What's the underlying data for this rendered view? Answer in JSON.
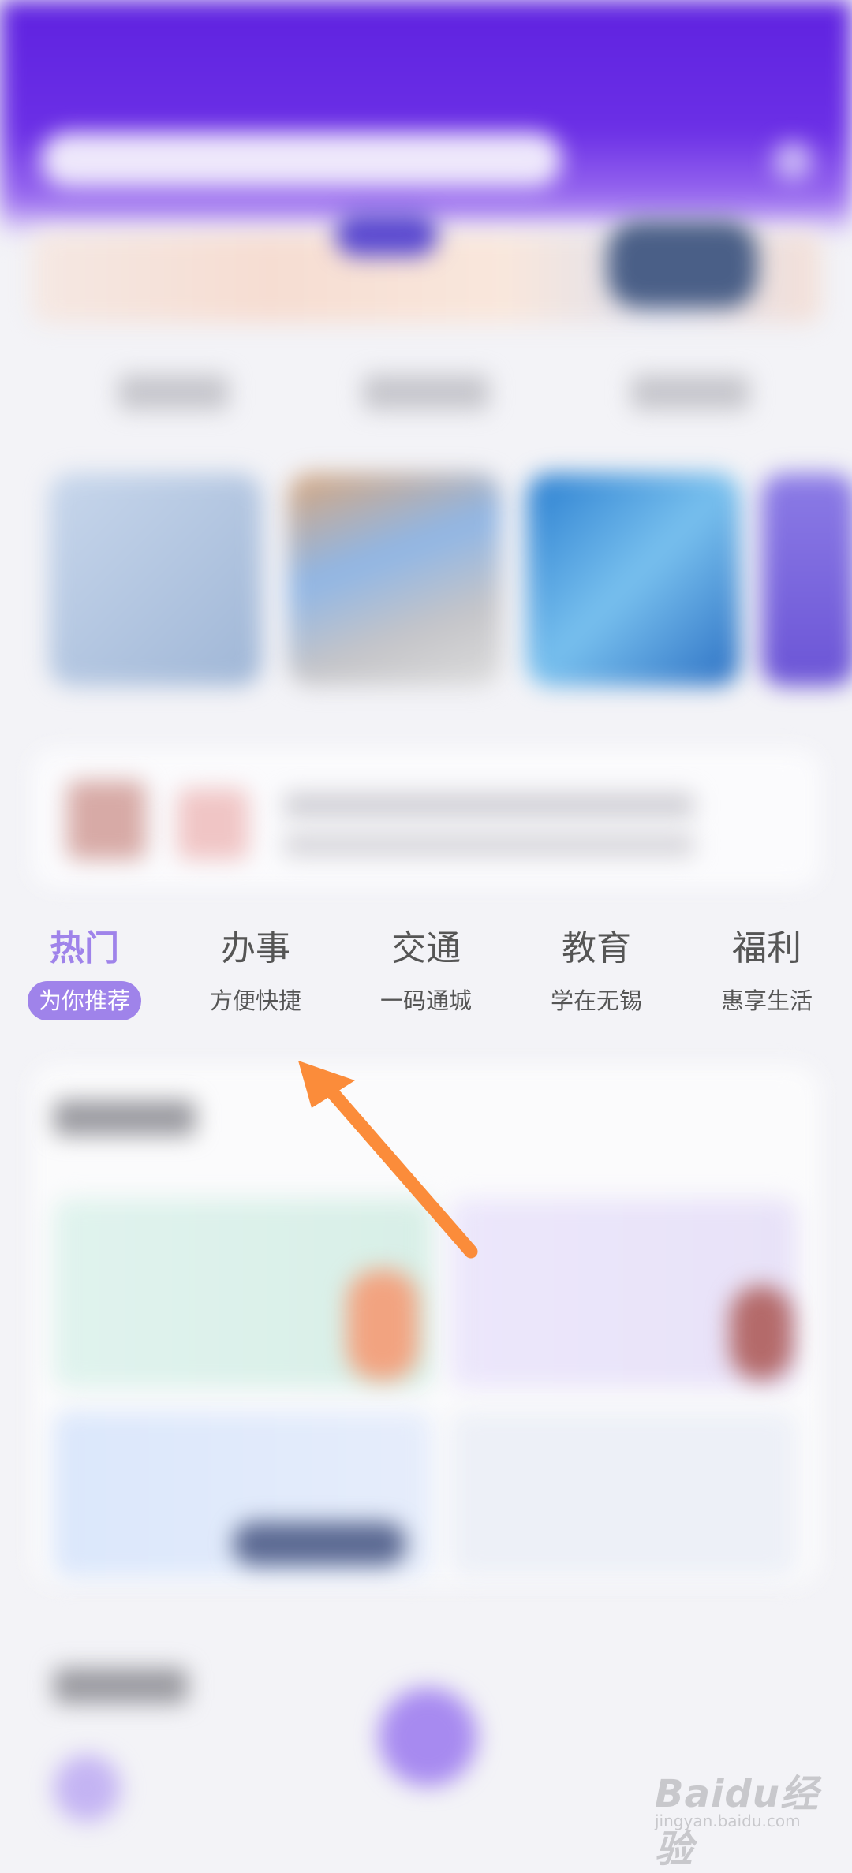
{
  "tabs": [
    {
      "title": "热门",
      "subtitle": "为你推荐",
      "active": true
    },
    {
      "title": "办事",
      "subtitle": "方便快捷",
      "active": false
    },
    {
      "title": "交通",
      "subtitle": "一码通城",
      "active": false
    },
    {
      "title": "教育",
      "subtitle": "学在无锡",
      "active": false
    },
    {
      "title": "福利",
      "subtitle": "惠享生活",
      "active": false
    }
  ],
  "colors": {
    "header": "#5f22e0",
    "active_tab": "#9f83ea",
    "arrow": "#fb8c3a",
    "background": "#f3f3f7"
  },
  "watermark": {
    "main": "Baidu经验",
    "sub": "jingyan.baidu.com"
  }
}
